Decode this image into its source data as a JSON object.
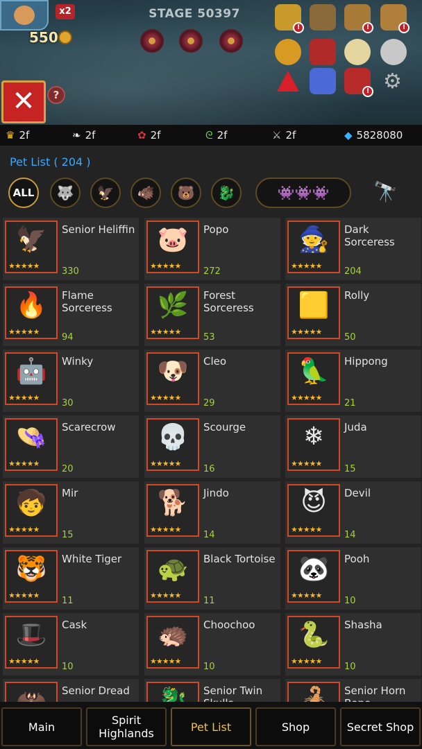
{
  "hud": {
    "ff_badge": "x2",
    "gold": "550",
    "stage": "STAGE 50397"
  },
  "close_label": "✕",
  "help_label": "?",
  "resources": [
    {
      "icon": "crown-icon",
      "glyph": "♛",
      "color": "#f5c31e",
      "value": "2f"
    },
    {
      "icon": "feather-icon",
      "glyph": "❧",
      "color": "#e9e9e9",
      "value": "2f"
    },
    {
      "icon": "red-fruit-icon",
      "glyph": "✿",
      "color": "#e0303a",
      "value": "2f"
    },
    {
      "icon": "green-vine-icon",
      "glyph": "ᘓ",
      "color": "#6ed94a",
      "value": "2f"
    },
    {
      "icon": "claw-icon",
      "glyph": "⚔",
      "color": "#c9c9d8",
      "value": "2f"
    },
    {
      "icon": "diamond-icon",
      "glyph": "◆",
      "color": "#39b3ff",
      "value": "5828080"
    }
  ],
  "pet_list_title": "Pet List ( 204 )",
  "filters": [
    {
      "name": "filter-all",
      "label": "ALL",
      "active": true
    },
    {
      "name": "filter-beast",
      "label": "",
      "glyph": "🐺"
    },
    {
      "name": "filter-bird",
      "label": "",
      "glyph": "🦅"
    },
    {
      "name": "filter-mammal",
      "label": "",
      "glyph": "🐗"
    },
    {
      "name": "filter-love",
      "label": "",
      "glyph": "🐻"
    },
    {
      "name": "filter-dragon",
      "label": "",
      "glyph": "🐉"
    },
    {
      "name": "filter-group",
      "label": "",
      "glyph": "👾👾👾"
    }
  ],
  "pets": [
    {
      "name": "Senior Heliffin",
      "count": "330",
      "glyph": "🦅",
      "stars": "★★★★★"
    },
    {
      "name": "Popo",
      "count": "272",
      "glyph": "🐷",
      "stars": "★★★★★"
    },
    {
      "name": "Dark Sorceress",
      "count": "204",
      "glyph": "🧙",
      "stars": "★★★★★"
    },
    {
      "name": "Flame Sorceress",
      "count": "94",
      "glyph": "🔥",
      "stars": "★★★★★"
    },
    {
      "name": "Forest Sorceress",
      "count": "53",
      "glyph": "🌿",
      "stars": "★★★★★"
    },
    {
      "name": "Rolly",
      "count": "50",
      "glyph": "🟨",
      "stars": "★★★★★"
    },
    {
      "name": "Winky",
      "count": "30",
      "glyph": "🤖",
      "stars": "★★★★★"
    },
    {
      "name": "Cleo",
      "count": "29",
      "glyph": "🐶",
      "stars": "★★★★★"
    },
    {
      "name": "Hippong",
      "count": "21",
      "glyph": "🦜",
      "stars": "★★★★★"
    },
    {
      "name": "Scarecrow",
      "count": "20",
      "glyph": "👒",
      "stars": "★★★★★"
    },
    {
      "name": "Scourge",
      "count": "16",
      "glyph": "💀",
      "stars": "★★★★★"
    },
    {
      "name": "Juda",
      "count": "15",
      "glyph": "❄",
      "stars": "★★★★★"
    },
    {
      "name": "Mir",
      "count": "15",
      "glyph": "🧒",
      "stars": "★★★★★"
    },
    {
      "name": "Jindo",
      "count": "14",
      "glyph": "🐕",
      "stars": "★★★★★"
    },
    {
      "name": "Devil",
      "count": "14",
      "glyph": "😈",
      "stars": "★★★★★"
    },
    {
      "name": "White Tiger",
      "count": "11",
      "glyph": "🐯",
      "stars": "★★★★★"
    },
    {
      "name": "Black Tortoise",
      "count": "11",
      "glyph": "🐢",
      "stars": "★★★★★"
    },
    {
      "name": "Pooh",
      "count": "10",
      "glyph": "🐼",
      "stars": "★★★★★"
    },
    {
      "name": "Cask",
      "count": "10",
      "glyph": "🎩",
      "stars": "★★★★★"
    },
    {
      "name": "Choochoo",
      "count": "10",
      "glyph": "🦔",
      "stars": "★★★★★"
    },
    {
      "name": "Shasha",
      "count": "10",
      "glyph": "🐍",
      "stars": "★★★★★"
    },
    {
      "name": "Senior Dread",
      "count": "",
      "glyph": "🦇",
      "stars": ""
    },
    {
      "name": "Senior Twin Skulls",
      "count": "",
      "glyph": "🐉",
      "stars": ""
    },
    {
      "name": "Senior Horn Bone",
      "count": "",
      "glyph": "🦂",
      "stars": ""
    }
  ],
  "tabs": [
    {
      "name": "tab-main",
      "label": "Main",
      "active": false
    },
    {
      "name": "tab-spirit-highlands",
      "label": "Spirit Highlands",
      "active": false
    },
    {
      "name": "tab-pet-list",
      "label": "Pet List",
      "active": true
    },
    {
      "name": "tab-shop",
      "label": "Shop",
      "active": false
    },
    {
      "name": "tab-secret-shop",
      "label": "Secret Shop",
      "active": false
    }
  ]
}
